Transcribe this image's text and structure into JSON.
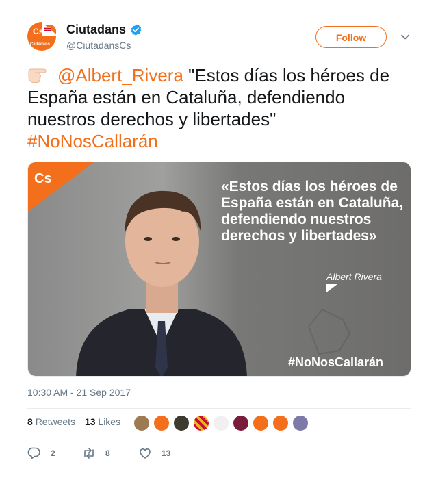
{
  "account": {
    "display_name": "Ciutadans",
    "handle": "@CiutadansCs",
    "avatar_text": "Cs",
    "avatar_subtext": "Ciutadans"
  },
  "follow_label": "Follow",
  "tweet": {
    "mention": "@Albert_Rivera",
    "text": " \"Estos días los héroes de España están en Cataluña, defendiendo nuestros derechos y libertades\"",
    "hashtag": "#NoNosCallarán"
  },
  "media": {
    "logo": "Cs",
    "quote": "«Estos días los héroes de España están en Cataluña, defendiendo nuestros derechos y libertades»",
    "author": "Albert Rivera",
    "hashtag": "#NoNosCallarán"
  },
  "timestamp": "10:30 AM - 21 Sep 2017",
  "stats": {
    "retweets_count": "8",
    "retweets_label": "Retweets",
    "likes_count": "13",
    "likes_label": "Likes"
  },
  "actions": {
    "replies": "2",
    "retweets": "8",
    "likes": "13"
  },
  "colors": {
    "brand": "#f46f1b",
    "verified": "#1da1f2",
    "muted": "#657786"
  }
}
